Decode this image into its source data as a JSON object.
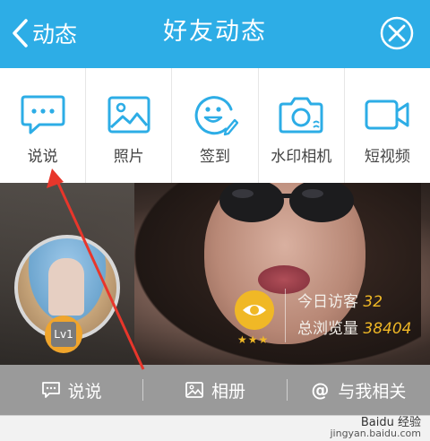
{
  "header": {
    "back_label": "动态",
    "title": "好友动态",
    "close_icon": "close-icon"
  },
  "toolbar": {
    "items": [
      {
        "label": "说说",
        "icon": "chat-bubble-icon"
      },
      {
        "label": "照片",
        "icon": "image-icon"
      },
      {
        "label": "签到",
        "icon": "smiley-pen-icon"
      },
      {
        "label": "水印相机",
        "icon": "camera-icon"
      },
      {
        "label": "短视频",
        "icon": "video-camera-icon"
      }
    ],
    "accent_color": "#2dade6"
  },
  "cover": {
    "level_badge": "Lv1",
    "stats": {
      "today_visitors_label": "今日访客",
      "today_visitors_value": "32",
      "total_views_label": "总浏览量",
      "total_views_value": "38404"
    }
  },
  "bottom_tabs": [
    {
      "label": "说说",
      "icon": "chat-bubble-icon"
    },
    {
      "label": "相册",
      "icon": "image-icon"
    },
    {
      "label": "与我相关",
      "icon": "at-icon",
      "glyph": "@"
    }
  ],
  "watermark": {
    "brand": "Baidu 经验",
    "url": "jingyan.baidu.com"
  }
}
